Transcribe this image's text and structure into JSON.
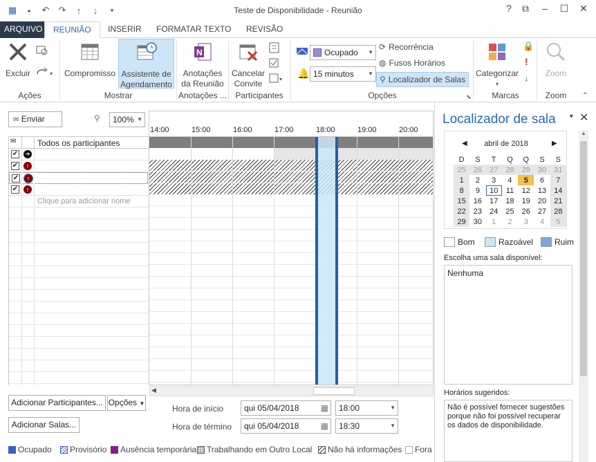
{
  "window": {
    "title": "Teste de Disponibilidade - Reunião"
  },
  "tabs": [
    "ARQUIVO",
    "REUNIÃO",
    "INSERIR",
    "FORMATAR TEXTO",
    "REVISÃO"
  ],
  "ribbon": {
    "acoes": {
      "label": "Ações",
      "excluir": "Excluir"
    },
    "mostrar": {
      "label": "Mostrar",
      "compromisso": "Compromisso",
      "assistente1": "Assistente de",
      "assistente2": "Agendamento"
    },
    "anotacoes": {
      "label": "Anotações ...",
      "anot1": "Anotações",
      "anot2": "da Reunião"
    },
    "participantes": {
      "label": "Participantes",
      "cancelar1": "Cancelar",
      "cancelar2": "Convite"
    },
    "opcoes": {
      "label": "Opções",
      "status": "Ocupado",
      "lembrete": "15 minutos",
      "recorrencia": "Recorrência",
      "fusos": "Fusos Horários",
      "localizador": "Localizador de Salas"
    },
    "marcas": {
      "label": "Marcas",
      "categorizar": "Categorizar"
    },
    "zoom": {
      "label": "Zoom",
      "zoom": "Zoom"
    }
  },
  "scheduler": {
    "enviar": "Enviar",
    "zoom_value": "100%",
    "all_attendees": "Todos os participantes",
    "add_name_hint": "Clique para adicionar nome",
    "times": [
      "14:00",
      "15:00",
      "16:00",
      "17:00",
      "18:00",
      "19:00",
      "20:00"
    ],
    "add_attendees": "Adicionar Participantes...",
    "options": "Opções",
    "add_rooms": "Adicionar Salas...",
    "start_label": "Hora de início",
    "end_label": "Hora de término",
    "start_date": "qui 05/04/2018",
    "start_time": "18:00",
    "end_date": "qui 05/04/2018",
    "end_time": "18:30"
  },
  "legend": [
    "Ocupado",
    "Provisório",
    "Ausência temporária",
    "Trabalhando em Outro Local",
    "Não há informações",
    "Fora"
  ],
  "panel": {
    "title": "Localizador de sala",
    "month": "abril de 2018",
    "weekdays": [
      "D",
      "S",
      "T",
      "Q",
      "Q",
      "S",
      "S"
    ],
    "weeks": [
      [
        "25",
        "26",
        "27",
        "28",
        "29",
        "30",
        "31"
      ],
      [
        "1",
        "2",
        "3",
        "4",
        "5",
        "6",
        "7"
      ],
      [
        "8",
        "9",
        "10",
        "11",
        "12",
        "13",
        "14"
      ],
      [
        "15",
        "16",
        "17",
        "18",
        "19",
        "20",
        "21"
      ],
      [
        "22",
        "23",
        "24",
        "25",
        "26",
        "27",
        "28"
      ],
      [
        "29",
        "30",
        "1",
        "2",
        "3",
        "4",
        "5"
      ]
    ],
    "quality": [
      "Bom",
      "Razoável",
      "Ruim"
    ],
    "choose_room": "Escolha uma sala disponível:",
    "room_value": "Nenhuma",
    "suggested": "Horários sugeridos:",
    "suggest_text": "Não é possível fornecer sugestões porque não foi possível recuperar os dados de disponibilidade."
  },
  "colors": {
    "accent": "#2a6ab8",
    "busy": "#3c5fcc",
    "selection": "#cde6f7",
    "file_tab": "#2b3b4b"
  }
}
